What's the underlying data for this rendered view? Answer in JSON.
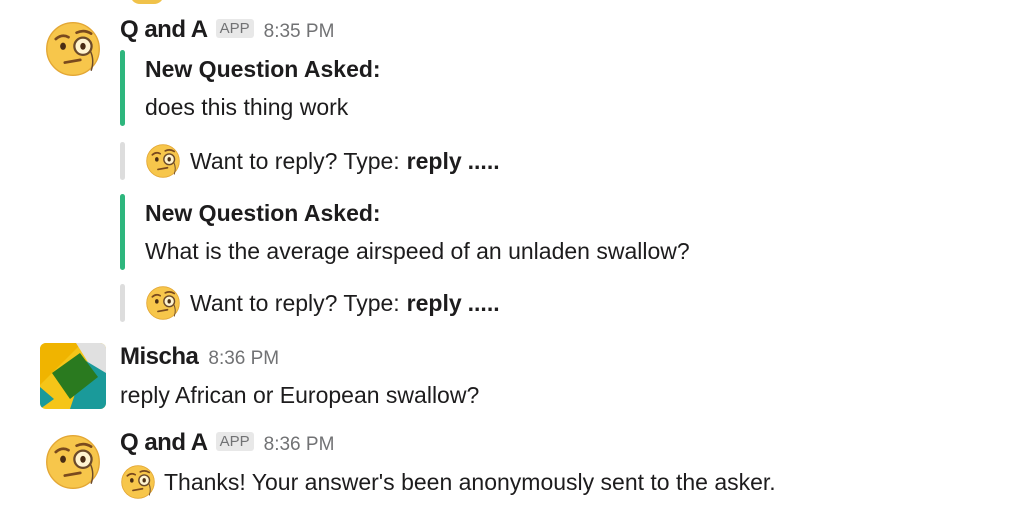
{
  "messages": [
    {
      "author": "Q and A",
      "badge": "APP",
      "time": "8:35 PM",
      "attachments": [
        {
          "title": "New Question Asked:",
          "text": "does this thing work"
        },
        {
          "prompt": "Want to reply? Type:",
          "keyword": "reply",
          "suffix": "....."
        },
        {
          "title": "New Question Asked:",
          "text": "What is the average airspeed of an unladen swallow?"
        },
        {
          "prompt": "Want to reply? Type:",
          "keyword": "reply",
          "suffix": "....."
        }
      ]
    },
    {
      "author": "Mischa",
      "time": "8:36 PM",
      "text": "reply African or European swallow?"
    },
    {
      "author": "Q and A",
      "badge": "APP",
      "time": "8:36 PM",
      "text": "Thanks! Your answer's been anonymously sent to the asker."
    }
  ],
  "icons": {
    "bot_avatar": "face-with-monocle-icon",
    "user_avatar": "geometric-avatar",
    "inline_emoji": "face-with-monocle-icon"
  },
  "colors": {
    "attachment_bar_green": "#2eb67d",
    "attachment_bar_grey": "#dddddd",
    "timestamp": "#717274",
    "badge_bg": "#e8e8e8"
  }
}
